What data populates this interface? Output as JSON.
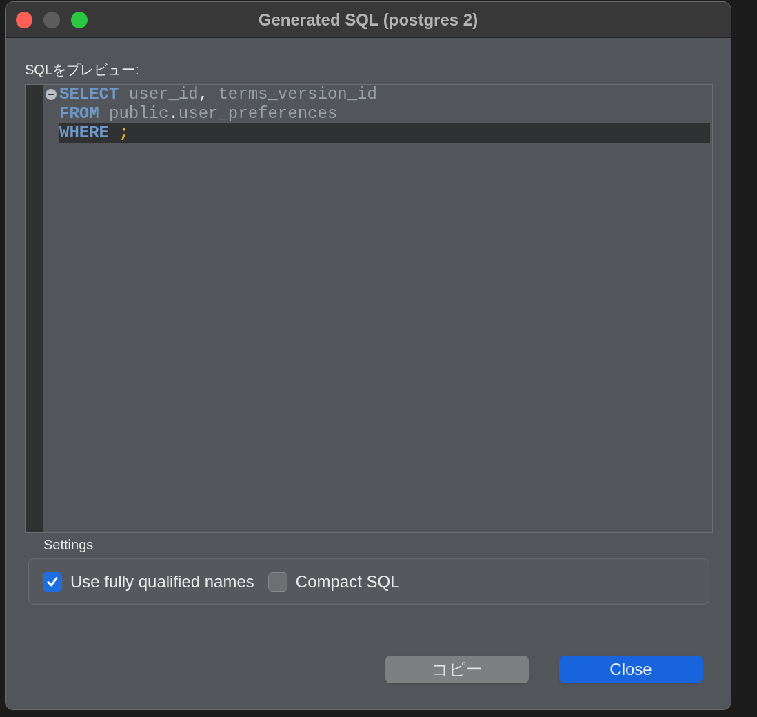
{
  "window": {
    "title": "Generated SQL (postgres 2)"
  },
  "preview": {
    "label": "SQLをプレビュー:",
    "lines": [
      {
        "fold": true,
        "current": false,
        "tokens": [
          {
            "kind": "keyword",
            "text": "SELECT"
          },
          {
            "kind": "ident",
            "text": " user_id"
          },
          {
            "kind": "punct",
            "text": ","
          },
          {
            "kind": "ident",
            "text": " terms_version_id"
          }
        ]
      },
      {
        "fold": false,
        "current": false,
        "tokens": [
          {
            "kind": "keyword",
            "text": "FROM"
          },
          {
            "kind": "ident",
            "text": " public"
          },
          {
            "kind": "punct",
            "text": "."
          },
          {
            "kind": "ident",
            "text": "user_preferences"
          }
        ]
      },
      {
        "fold": false,
        "current": true,
        "tokens": [
          {
            "kind": "keyword",
            "text": "WHERE"
          },
          {
            "kind": "end",
            "text": " ;"
          }
        ]
      }
    ]
  },
  "settings": {
    "label": "Settings",
    "options": [
      {
        "label": "Use fully qualified names",
        "checked": true
      },
      {
        "label": "Compact SQL",
        "checked": false
      }
    ]
  },
  "buttons": [
    {
      "label": "コピー",
      "kind": "secondary"
    },
    {
      "label": "Close",
      "kind": "primary"
    }
  ]
}
